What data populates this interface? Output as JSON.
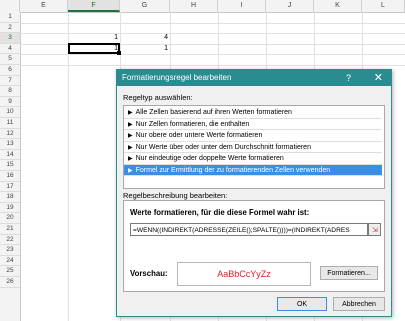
{
  "spreadsheet": {
    "columns": [
      "E",
      "F",
      "G",
      "H",
      "I",
      "J",
      "K",
      "L"
    ],
    "selected_column": "F",
    "rows": [
      "1",
      "2",
      "3",
      "4",
      "5",
      "6",
      "7",
      "8",
      "9",
      "10",
      "11",
      "12",
      "13",
      "14",
      "15",
      "16",
      "17",
      "18",
      "19",
      "20",
      "21",
      "22",
      "23",
      "24",
      "25",
      "26"
    ],
    "selected_row": "3",
    "cells": {
      "F2": "1",
      "G2": "4",
      "F3": "1",
      "G3": "1"
    }
  },
  "dialog": {
    "title": "Formatierungsregel bearbeiten",
    "help": "?",
    "close": "✕",
    "rule_type_label": "Regeltyp auswählen:",
    "rule_types": [
      "Alle Zellen basierend auf ihren Werten formatieren",
      "Nur Zellen formatieren, die enthalten",
      "Nur obere oder untere Werte formatieren",
      "Nur Werte über oder unter dem Durchschnitt formatieren",
      "Nur eindeutige oder doppelte Werte formatieren",
      "Formel zur Ermittlung der zu formatierenden Zellen verwenden"
    ],
    "selected_rule_index": 5,
    "rule_desc_label": "Regelbeschreibung bearbeiten:",
    "formula_label": "Werte formatieren, für die diese Formel wahr ist:",
    "formula_value": "=WENN((INDIREKT(ADRESSE(ZEILE();SPALTE())))=(INDIREKT(ADRES",
    "preview_label": "Vorschau:",
    "preview_text": "AaBbCcYyZz",
    "format_button": "Formatieren...",
    "ok_button": "OK",
    "cancel_button": "Abbrechen"
  }
}
